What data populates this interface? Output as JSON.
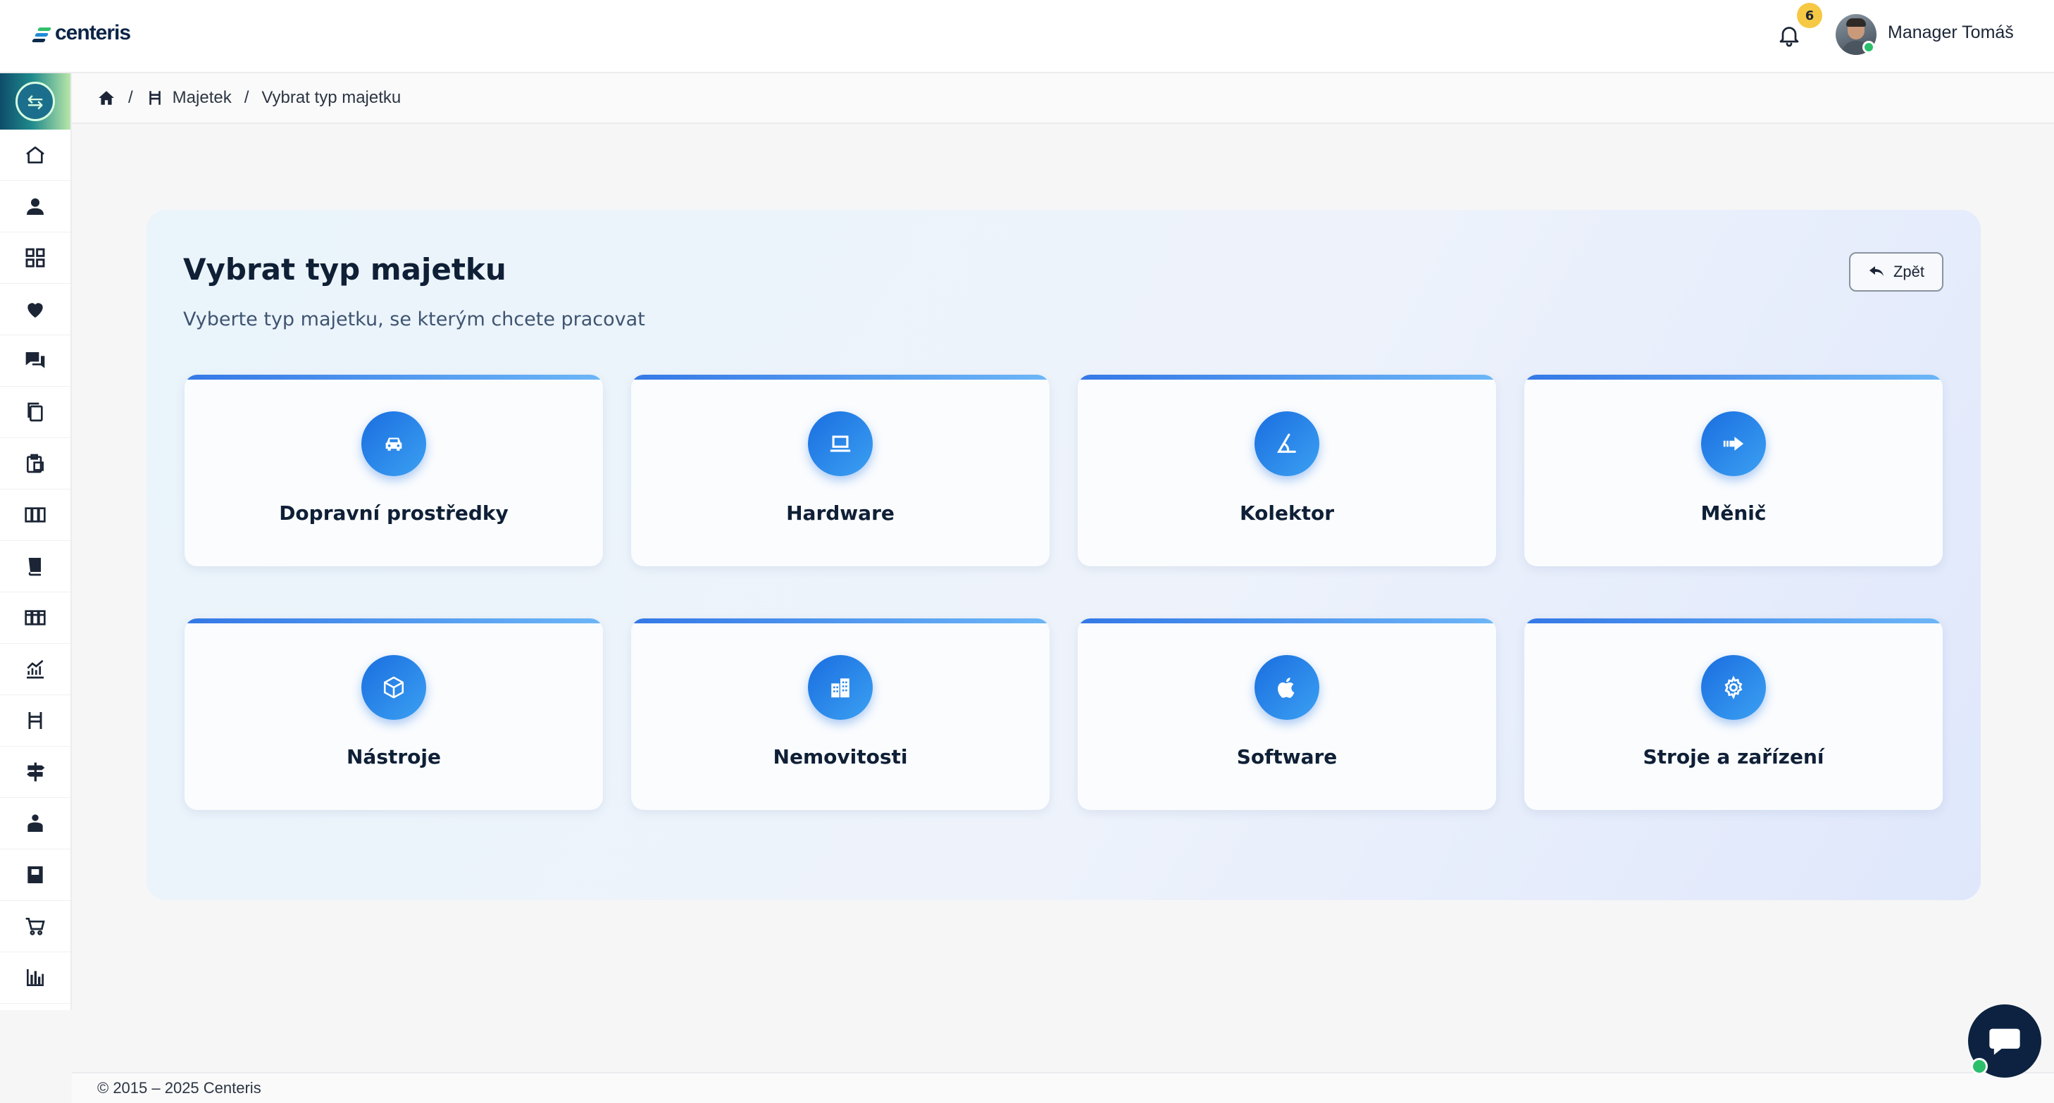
{
  "app": {
    "brand": "centeris",
    "notifications_count": "6",
    "user_name": "Manager Tomáš"
  },
  "sidebar": {
    "items": [
      {
        "icon": "home-icon"
      },
      {
        "icon": "user-icon"
      },
      {
        "icon": "grid-icon"
      },
      {
        "icon": "heart-icon"
      },
      {
        "icon": "chat-icon"
      },
      {
        "icon": "copy-icon"
      },
      {
        "icon": "clipboard-icon"
      },
      {
        "icon": "binders-icon"
      },
      {
        "icon": "book-icon"
      },
      {
        "icon": "binders-alt-icon"
      },
      {
        "icon": "chart-line-icon"
      },
      {
        "icon": "chair-icon"
      },
      {
        "icon": "signpost-icon"
      },
      {
        "icon": "person-desk-icon"
      },
      {
        "icon": "notebook-icon"
      },
      {
        "icon": "cart-icon"
      },
      {
        "icon": "bar-chart-icon"
      }
    ]
  },
  "breadcrumb": {
    "separator": "/",
    "items": [
      "Majetek",
      "Vybrat typ majetku"
    ]
  },
  "page": {
    "title": "Vybrat typ majetku",
    "subtitle": "Vyberte typ majetku, se kterým chcete pracovat",
    "back_label": "Zpět"
  },
  "asset_types": [
    {
      "label": "Dopravní prostředky",
      "icon": "car-icon"
    },
    {
      "label": "Hardware",
      "icon": "laptop-icon"
    },
    {
      "label": "Kolektor",
      "icon": "angle-icon"
    },
    {
      "label": "Měnič",
      "icon": "converter-arrow-icon"
    },
    {
      "label": "Nástroje",
      "icon": "box-icon"
    },
    {
      "label": "Nemovitosti",
      "icon": "building-icon"
    },
    {
      "label": "Software",
      "icon": "apple-icon"
    },
    {
      "label": "Stroje a zařízení",
      "icon": "gear-icon"
    }
  ],
  "footer": {
    "copyright": "© 2015 – 2025 Centeris"
  },
  "colors": {
    "accent": "#1a6ee0",
    "accent_light": "#3ba0f2",
    "notification": "#f6c945",
    "online": "#2bbf6b",
    "chat": "#0c2240"
  }
}
